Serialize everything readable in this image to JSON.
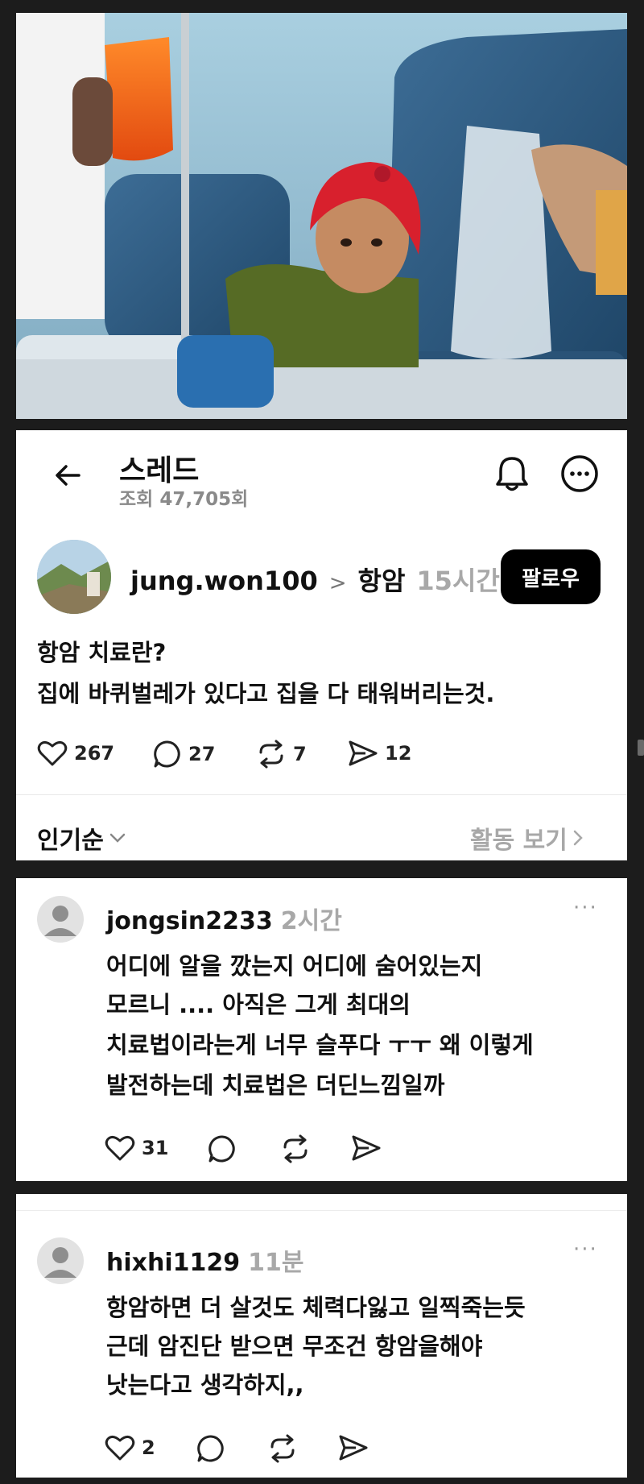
{
  "header": {
    "title": "스레드",
    "views": "조회 47,705회"
  },
  "post": {
    "username": "jung.won100",
    "topic_sep": ">",
    "topic": "항암",
    "time": "15시간",
    "follow_label": "팔로우",
    "text_lines": [
      "항암 치료란?",
      "집에 바퀴벌레가 있다고 집을 다 태워버리는것."
    ],
    "likes": "267",
    "comments": "27",
    "reposts": "7",
    "shares": "12"
  },
  "sort": {
    "label": "인기순",
    "activity_label": "활동 보기"
  },
  "replies": [
    {
      "username": "jongsin2233",
      "time": "2시간",
      "more": "···",
      "lines": [
        "어디에 알을 깠는지 어디에 숨어있는지",
        "모르니 .... 아직은 그게 최대의",
        "치료법이라는게 너무 슬푸다 ㅜㅜ 왜 이렇게",
        "발전하는데 치료법은 더딘느낌일까"
      ],
      "likes": "31"
    },
    {
      "username": "hixhi1129",
      "time": "11분",
      "more": "···",
      "lines": [
        "항암하면 더 살것도 체력다잃고 일찍죽는듯",
        "근데 암진단 받으면 무조건 항암을해야",
        "낫는다고 생각하지,,"
      ],
      "likes": "2"
    }
  ],
  "colors": {
    "background": "#1c1c1c",
    "panel": "#ffffff",
    "follow_button": "#000000",
    "muted_text": "#a8a8a8"
  }
}
